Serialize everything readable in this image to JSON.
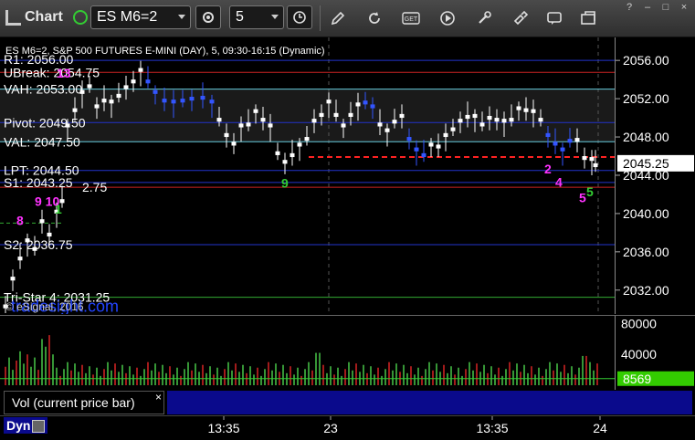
{
  "toolbar": {
    "app_label": "Chart",
    "symbol": "ES M6=2",
    "interval": "5",
    "icons": [
      "chart-bars-icon",
      "link-dot-icon",
      "gear-icon",
      "clock-icon",
      "pencil-icon",
      "refresh-icon",
      "get-icon",
      "play-icon",
      "tools-icon",
      "comment-icon",
      "snapshot-icon"
    ],
    "window_controls": [
      "?",
      "–",
      "□",
      "×"
    ]
  },
  "chart_data": {
    "type": "bar",
    "title": "ES M6=2, S&P 500 FUTURES E-MINI (DAY), 5, 09:30-16:15 (Dynamic)",
    "copyright": "© eSignal, 2016",
    "watermark": "tradesight.com",
    "price_axis": {
      "ticks": [
        "2056.00",
        "2052.00",
        "2048.00",
        "2044.00",
        "2040.00",
        "2036.00",
        "2032.00"
      ],
      "min": 2029.5,
      "max": 2058.4,
      "last_price": "2045.25"
    },
    "volume_axis": {
      "ticks": [
        "80000",
        "40000"
      ],
      "last_volume": "8569",
      "max": 80000
    },
    "time_axis": {
      "ticks": [
        "13:35",
        "23",
        "13:35",
        "24"
      ]
    },
    "levels": [
      {
        "label": "R1: 2056.00",
        "value": 2056.0,
        "color": "#2233cc"
      },
      {
        "label": "UBreak: 2054.75",
        "value": 2054.75,
        "color": "#cc2222"
      },
      {
        "label": "VAH: 2053.00",
        "value": 2053.0,
        "color": "#66ccdd"
      },
      {
        "label": "Pivot: 2049.50",
        "value": 2049.5,
        "color": "#2233cc"
      },
      {
        "label": "VAL: 2047.50",
        "value": 2047.5,
        "color": "#66ccdd"
      },
      {
        "label": "LPT: 2044.50",
        "value": 2044.5,
        "color": "#2233cc"
      },
      {
        "label": "S1: 2043.25",
        "value": 2043.25,
        "color": "#2233cc"
      },
      {
        "label": "2.75",
        "value": 2042.75,
        "color": "#cc2222"
      },
      {
        "label": "S2: 2036.75",
        "value": 2036.75,
        "color": "#2233cc"
      },
      {
        "label": "Tri-Star 4: 2031.25",
        "value": 2031.25,
        "color": "#33aa33"
      }
    ],
    "annotations": [
      {
        "text": "13",
        "color": "#ff33ff"
      },
      {
        "text": "8",
        "color": "#ff33ff"
      },
      {
        "text": "9 10",
        "color": "#ff33ff"
      },
      {
        "text": "1",
        "color": "#33cc33"
      },
      {
        "text": "2",
        "color": "#ff33ff"
      },
      {
        "text": "4",
        "color": "#ff33ff"
      },
      {
        "text": "5",
        "color": "#ff33ff"
      },
      {
        "text": "9",
        "color": "#33cc33"
      },
      {
        "text": "5",
        "color": "#33cc33"
      }
    ],
    "session_close": [
      {
        "time": "13:35",
        "close": 2051.2
      },
      {
        "time": "23",
        "close": 2046.0
      },
      {
        "time": "13:35",
        "close": 2050.6
      },
      {
        "time": "24",
        "close": 2045.25
      }
    ],
    "volume_series": [
      {
        "name": "Vol (current price bar)",
        "values": []
      }
    ]
  },
  "volume_pane": {
    "label": "Vol (current price bar)",
    "close": "×"
  },
  "bottom": {
    "dyn_label": "Dyn"
  }
}
